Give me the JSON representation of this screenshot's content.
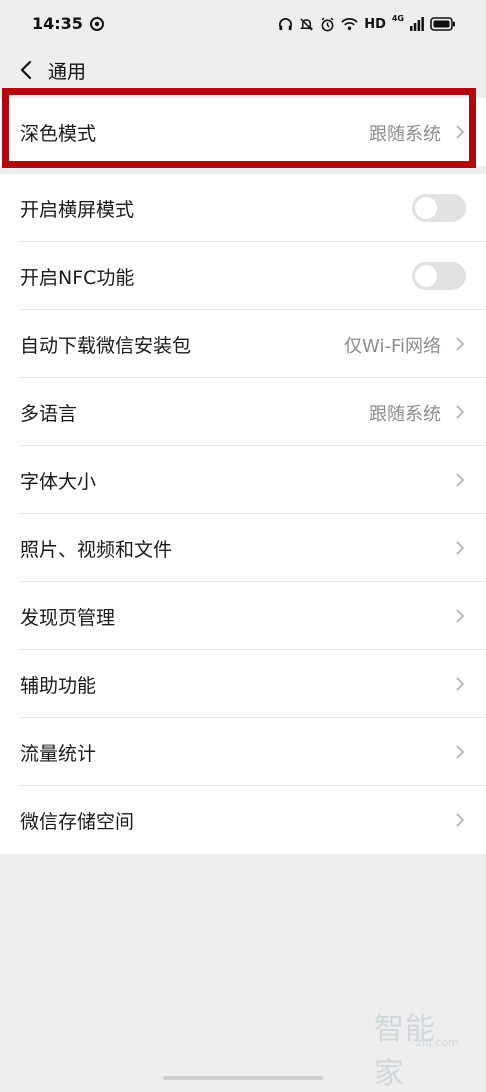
{
  "status_bar": {
    "time": "14:35",
    "hd_label": "HD",
    "network_label": "4G",
    "icons": [
      "app-notification-icon",
      "headphones-icon",
      "bell-muted-icon",
      "alarm-icon",
      "wifi-icon",
      "cellular-signal-icon",
      "battery-icon"
    ]
  },
  "header": {
    "title": "通用",
    "back_icon": "chevron-left-icon"
  },
  "settings": {
    "dark_mode": {
      "label": "深色模式",
      "value": "跟随系统"
    },
    "landscape": {
      "label": "开启横屏模式",
      "enabled": false
    },
    "nfc": {
      "label": "开启NFC功能",
      "enabled": false
    },
    "auto_download": {
      "label": "自动下载微信安装包",
      "value": "仅Wi-Fi网络"
    },
    "language": {
      "label": "多语言",
      "value": "跟随系统"
    },
    "font_size": {
      "label": "字体大小"
    },
    "media": {
      "label": "照片、视频和文件"
    },
    "discover": {
      "label": "发现页管理"
    },
    "accessibility": {
      "label": "辅助功能"
    },
    "traffic": {
      "label": "流量统计"
    },
    "storage": {
      "label": "微信存储空间"
    }
  },
  "highlight_color": "#b3080e",
  "watermark": {
    "text": "智能家",
    "sub": "znj.com"
  }
}
